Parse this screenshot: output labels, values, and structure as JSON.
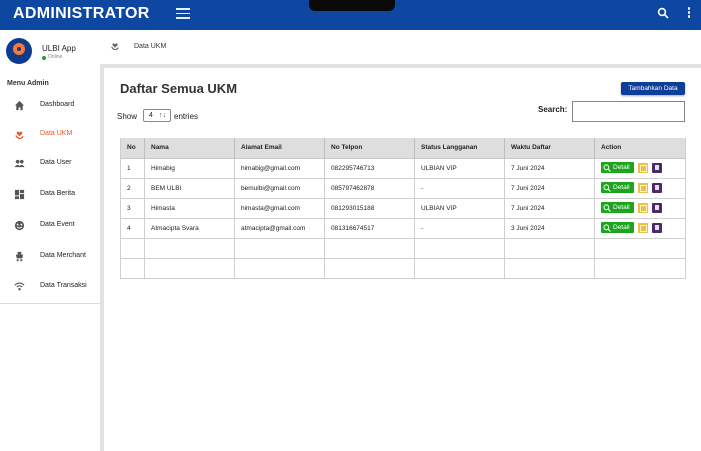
{
  "app": {
    "title": "ADMINISTRATOR"
  },
  "profile": {
    "name": "ULBI App",
    "status": "Online",
    "logo_text": "ULBI APP"
  },
  "sidebar": {
    "title": "Menu Admin",
    "items": [
      {
        "label": "Dashboard",
        "icon": "home-icon"
      },
      {
        "label": "Data UKM",
        "icon": "hand-heart-icon",
        "active": true
      },
      {
        "label": "Data User",
        "icon": "users-icon"
      },
      {
        "label": "Data Berita",
        "icon": "dashboard-grid-icon"
      },
      {
        "label": "Data Event",
        "icon": "event-icon"
      },
      {
        "label": "Data Merchant",
        "icon": "merchant-icon"
      },
      {
        "label": "Data Transaksi",
        "icon": "wifi-icon"
      }
    ]
  },
  "breadcrumb": {
    "label": "Data UKM"
  },
  "main": {
    "title": "Daftar Semua UKM",
    "add_button": "Tambahkan Data",
    "show_label": "Show",
    "entries_value": "4",
    "entries_label": "entries",
    "search_label": "Search:",
    "search_value": ""
  },
  "table": {
    "headers": [
      "No",
      "Nama",
      "Alamat Email",
      "No Telpon",
      "Status Langganan",
      "Waktu Daftar",
      "Action"
    ],
    "rows": [
      [
        "1",
        "Himabig",
        "himabig@gmail.com",
        "082295746713",
        "ULBIAN VIP",
        "7 Juni 2024"
      ],
      [
        "2",
        "BEM ULBI",
        "bemulbi@gmail.com",
        "085797462878",
        "-",
        "7 Juni 2024"
      ],
      [
        "3",
        "Himasta",
        "himasta@gmail.com",
        "081293015188",
        "ULBIAN VIP",
        "7 Juni 2024"
      ],
      [
        "4",
        "Atmacipta Svara",
        "atmacipta@gmail.com",
        "081316674517",
        "-",
        "3 Juni 2024"
      ]
    ],
    "detail_label": "Detail"
  },
  "colors": {
    "topbar": "#0d47a1",
    "active": "#e8562a",
    "detail": "#1ea51e",
    "edit": "#e8c04a",
    "delete": "#4b2a6b"
  }
}
